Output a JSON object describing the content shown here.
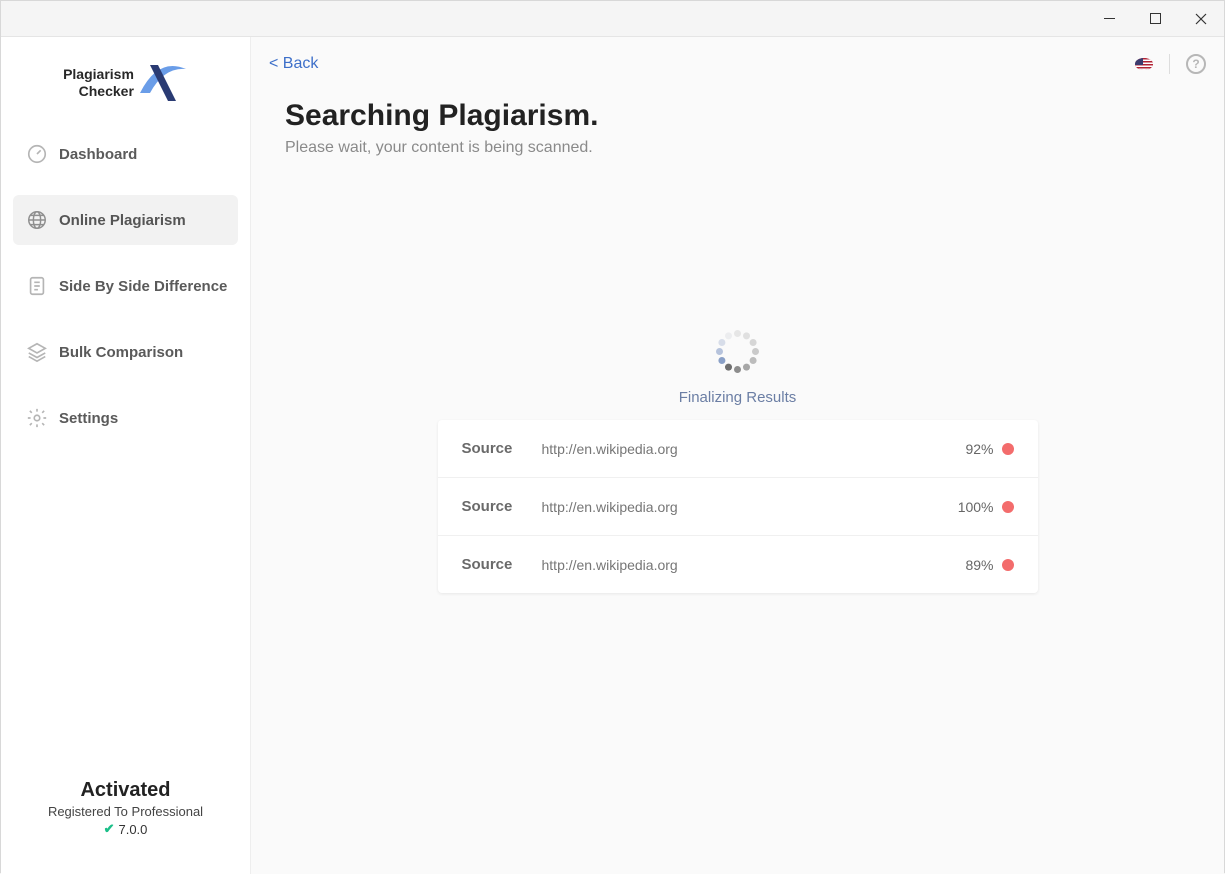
{
  "window": {
    "minimize": "–",
    "maximize": "□",
    "close": "×"
  },
  "logo": {
    "line1": "Plagiarism",
    "line2": "Checker"
  },
  "nav": {
    "dashboard": "Dashboard",
    "online": "Online Plagiarism",
    "side": "Side By Side Difference",
    "bulk": "Bulk Comparison",
    "settings": "Settings"
  },
  "license": {
    "status": "Activated",
    "registered": "Registered To Professional",
    "version": "7.0.0"
  },
  "back": "<  Back",
  "help": "?",
  "page": {
    "title": "Searching Plagiarism.",
    "subtitle": "Please wait, your content is being scanned.",
    "status": "Finalizing Results",
    "source_label": "Source",
    "results": [
      {
        "url": "http://en.wikipedia.org",
        "percent": "92%"
      },
      {
        "url": "http://en.wikipedia.org",
        "percent": "100%"
      },
      {
        "url": "http://en.wikipedia.org",
        "percent": "89%"
      }
    ]
  }
}
